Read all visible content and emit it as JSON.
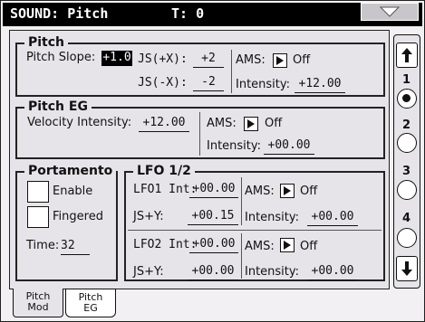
{
  "header": {
    "title": "SOUND: Pitch",
    "track": "T: 0",
    "menu_icon": "triangle-down-icon"
  },
  "pitch": {
    "title": "Pitch",
    "slope_label": "Pitch Slope:",
    "slope_value": "+1.0",
    "js_plus_x_label": "JS(+X):",
    "js_plus_x_value": "+2",
    "js_minus_x_label": "JS(-X):",
    "js_minus_x_value": "-2",
    "ams_label": "AMS:",
    "ams_value": "Off",
    "intensity_label": "Intensity:",
    "intensity_value": "+12.00"
  },
  "pitch_eg": {
    "title": "Pitch EG",
    "velocity_label": "Velocity Intensity:",
    "velocity_value": "+12.00",
    "ams_label": "AMS:",
    "ams_value": "Off",
    "intensity_label": "Intensity:",
    "intensity_value": "+00.00"
  },
  "portamento": {
    "title": "Portamento",
    "enable_label": "Enable",
    "enable_checked": false,
    "fingered_label": "Fingered",
    "fingered_checked": false,
    "time_label": "Time:",
    "time_value": "32"
  },
  "lfo": {
    "title": "LFO 1/2",
    "lfo1": {
      "int_label": "LFO1 Int:",
      "int_value": "+00.00",
      "ams_label": "AMS:",
      "ams_value": "Off",
      "js_label": "JS+Y:",
      "js_value": "+00.15",
      "intensity_label": "Intensity:",
      "intensity_value": "+00.00"
    },
    "lfo2": {
      "int_label": "LFO2 Int:",
      "int_value": "+00.00",
      "ams_label": "AMS:",
      "ams_value": "Off",
      "js_label": "JS+Y:",
      "js_value": "+00.00",
      "intensity_label": "Intensity:",
      "intensity_value": "+00.00"
    }
  },
  "pager": {
    "pages": [
      "1",
      "2",
      "3",
      "4"
    ],
    "selected": "1"
  },
  "tabs": [
    {
      "line1": "Pitch",
      "line2": "Mod",
      "active": true
    },
    {
      "line1": "Pitch",
      "line2": "EG",
      "active": false
    }
  ]
}
